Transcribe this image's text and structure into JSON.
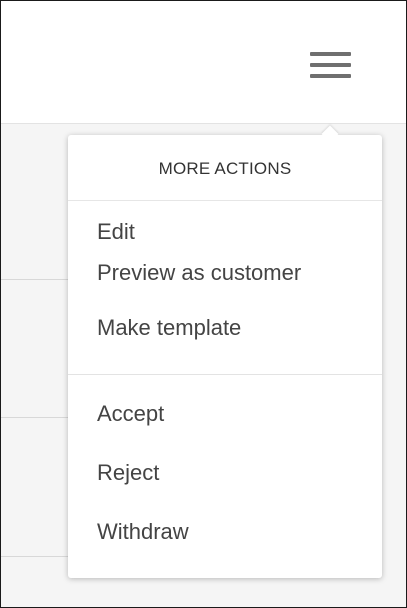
{
  "header": {
    "menu_icon": "hamburger-menu-icon"
  },
  "dropdown": {
    "title": "MORE ACTIONS",
    "groups": [
      {
        "items": [
          {
            "label": "Edit"
          },
          {
            "label": "Preview as customer"
          },
          {
            "label": "Make template"
          }
        ]
      },
      {
        "items": [
          {
            "label": "Accept"
          },
          {
            "label": "Reject"
          },
          {
            "label": "Withdraw"
          }
        ]
      }
    ]
  },
  "colors": {
    "page_background": "#f5f5f5",
    "panel_background": "#ffffff",
    "icon": "#6f6f6f",
    "text": "#444444"
  }
}
